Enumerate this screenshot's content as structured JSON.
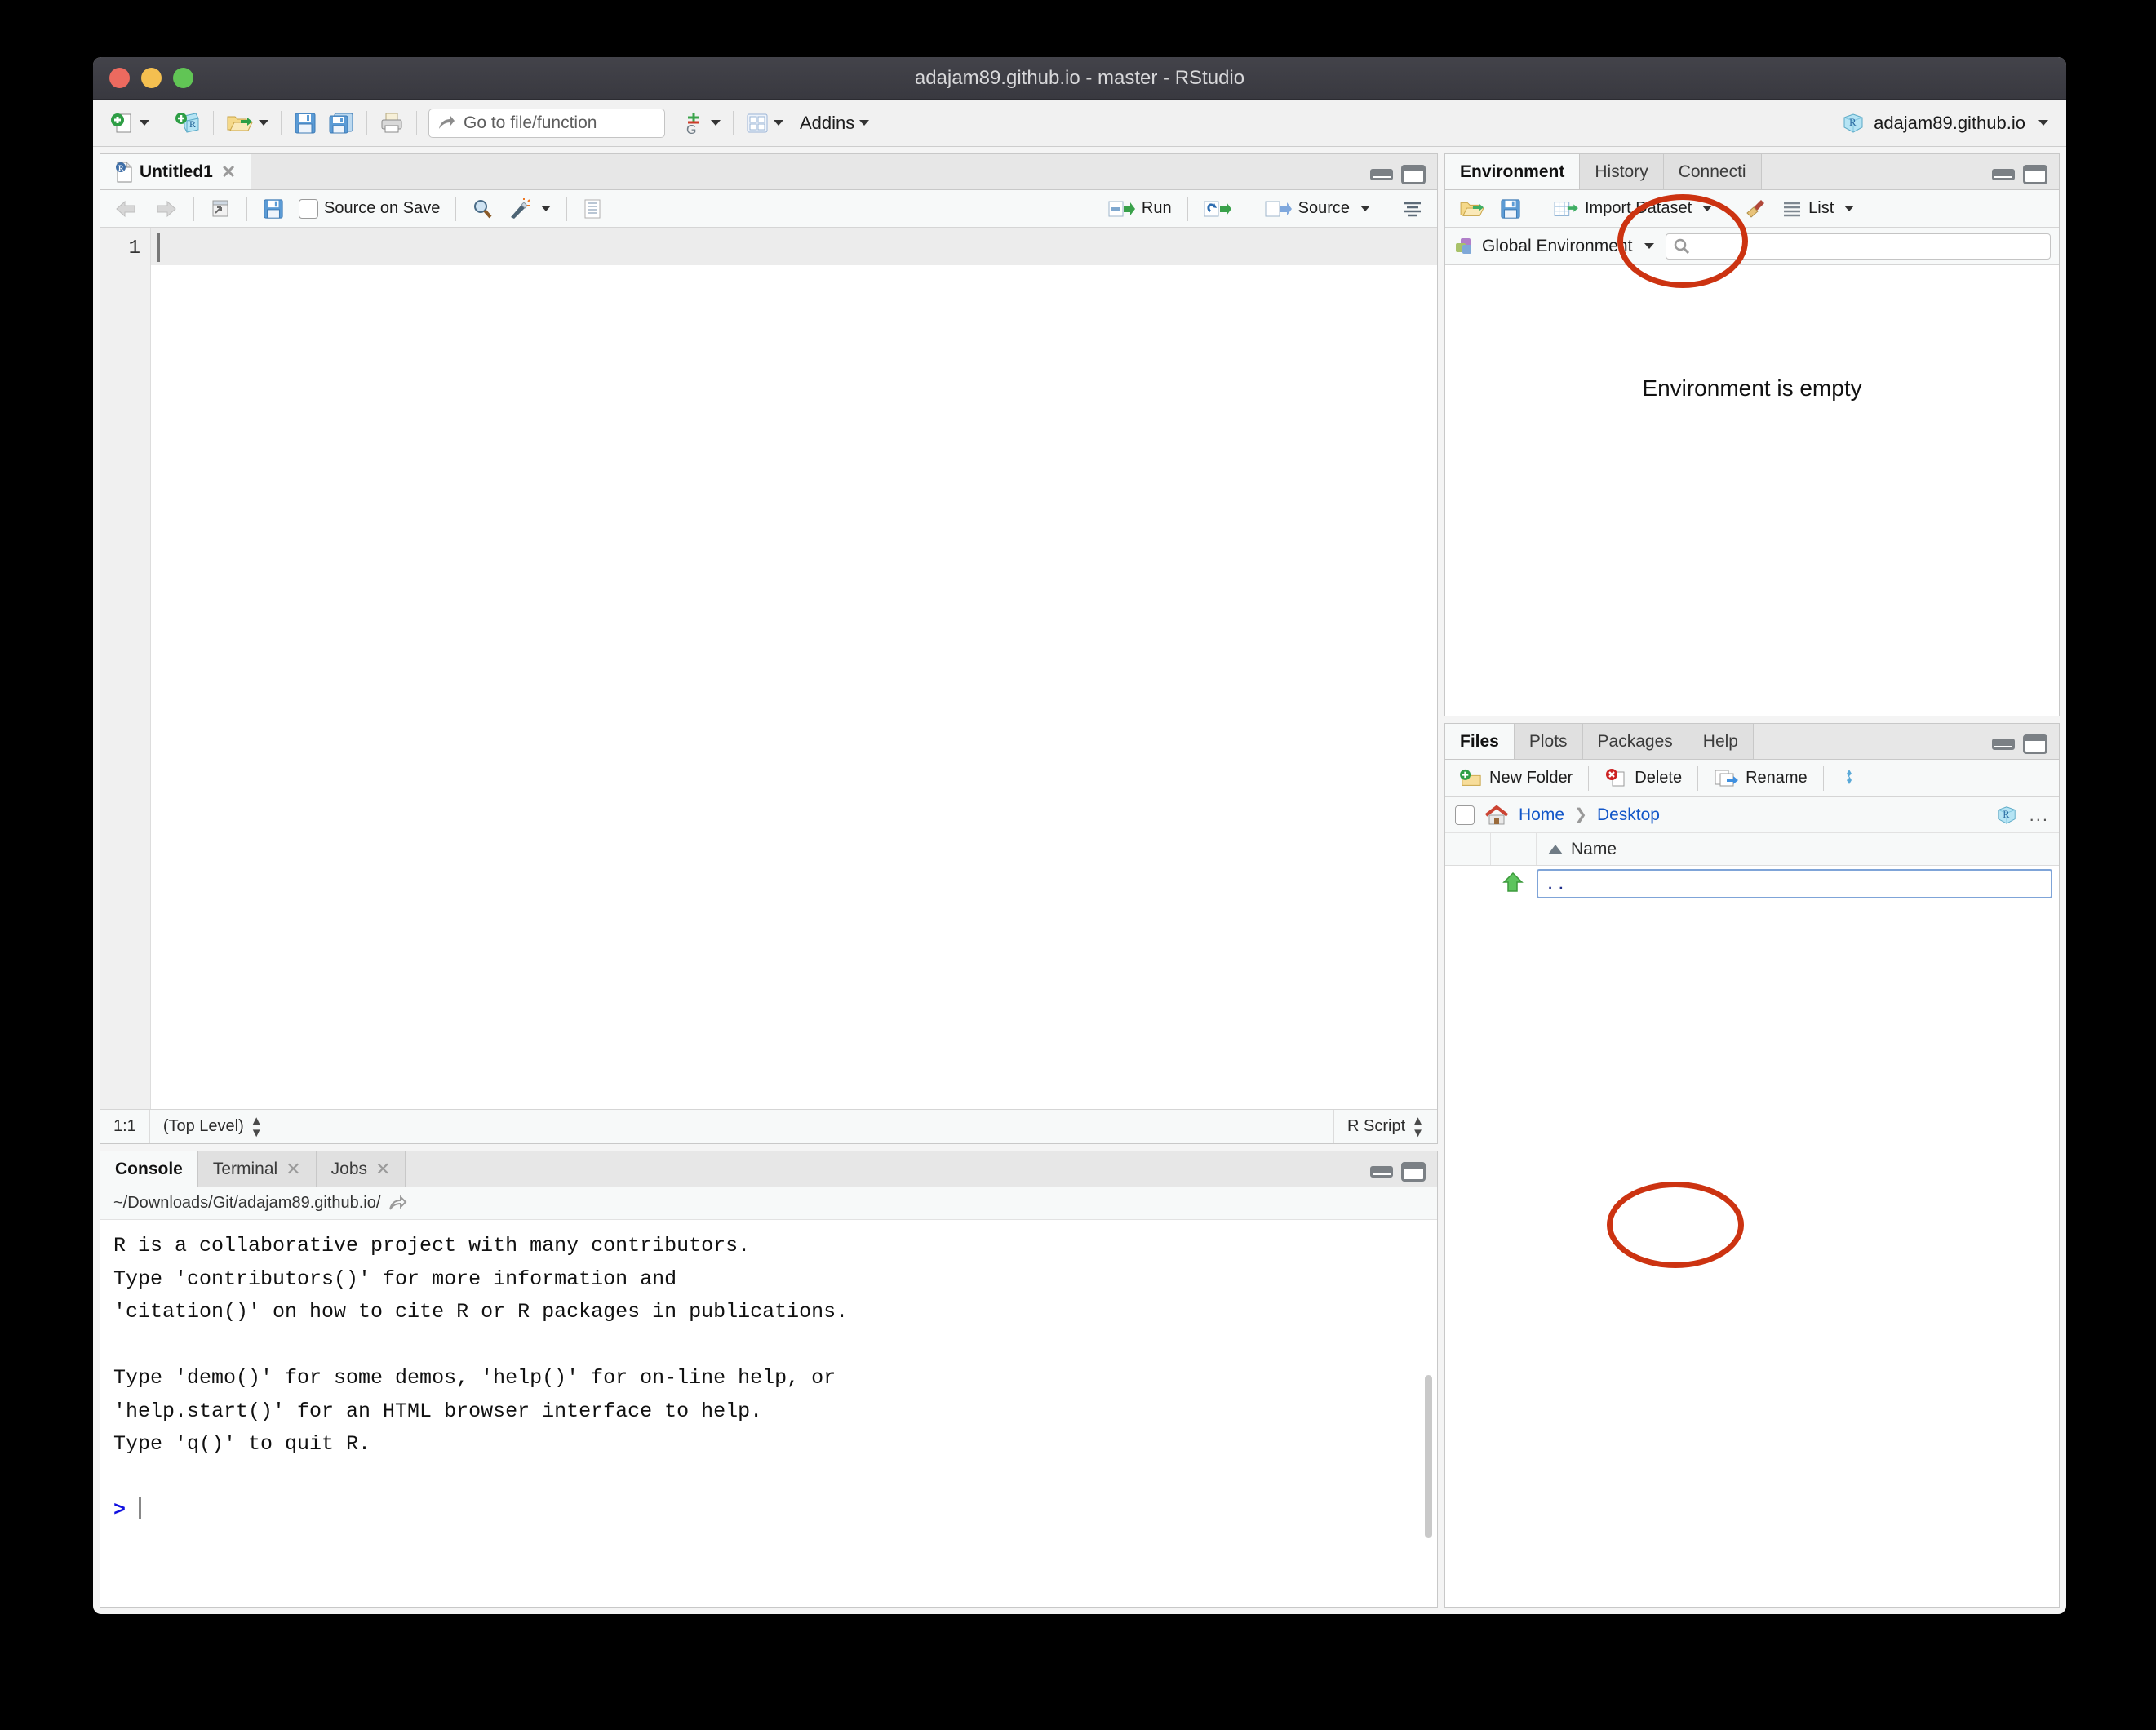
{
  "window": {
    "title": "adajam89.github.io - master - RStudio",
    "traffic_lights": [
      "close-button",
      "minimize-button",
      "maximize-button"
    ]
  },
  "toolbar": {
    "new_file_label": "new-file-icon",
    "new_project_label": "new-project-icon",
    "open_file_label": "open-file-icon",
    "save_label": "save-icon",
    "save_all_label": "save-all-icon",
    "print_label": "print-icon",
    "goto_placeholder": "Go to file/function",
    "git_label": "git-icon",
    "panes_label": "workspace-panes-icon",
    "addins_label": "Addins",
    "project_label": "adajam89.github.io"
  },
  "source": {
    "tabs": [
      {
        "label": "Untitled1",
        "closable": true,
        "active": true
      }
    ],
    "toolbar": {
      "back": "back-arrow-icon",
      "forward": "forward-arrow-icon",
      "popout": "show-in-new-window-icon",
      "save": "save-icon",
      "source_on_save": "Source on Save",
      "find": "find-icon",
      "code_tools": "code-tools-icon",
      "outline": "document-outline-icon",
      "run": "Run",
      "rerun": "re-run-icon",
      "source": "Source"
    },
    "line_numbers": [
      "1"
    ],
    "content": "",
    "status": {
      "cursor_position": "1:1",
      "scope": "(Top Level)",
      "file_type": "R Script"
    }
  },
  "console": {
    "tabs": [
      {
        "label": "Console",
        "closable": false,
        "active": true
      },
      {
        "label": "Terminal",
        "closable": true,
        "active": false
      },
      {
        "label": "Jobs",
        "closable": true,
        "active": false
      }
    ],
    "working_directory": "~/Downloads/Git/adajam89.github.io/",
    "output_lines": [
      "R is a collaborative project with many contributors.",
      "Type 'contributors()' for more information and",
      "'citation()' on how to cite R or R packages in publications.",
      "",
      "Type 'demo()' for some demos, 'help()' for on-line help, or",
      "'help.start()' for an HTML browser interface to help.",
      "Type 'q()' to quit R.",
      ""
    ],
    "prompt": ">"
  },
  "environment": {
    "tabs": [
      {
        "label": "Environment",
        "active": true
      },
      {
        "label": "History",
        "active": false
      },
      {
        "label": "Connecti",
        "active": false
      }
    ],
    "toolbar": {
      "load": "open-workspace-icon",
      "save": "save-workspace-icon",
      "import_dataset": "Import Dataset",
      "clear": "broom-icon",
      "view_mode": "List"
    },
    "scope_selector": "Global Environment",
    "search_placeholder": "",
    "empty_message": "Environment is empty"
  },
  "files": {
    "tabs": [
      {
        "label": "Files",
        "active": true
      },
      {
        "label": "Plots",
        "active": false
      },
      {
        "label": "Packages",
        "active": false
      },
      {
        "label": "Help",
        "active": false
      }
    ],
    "toolbar": {
      "new_folder": "New Folder",
      "delete": "Delete",
      "rename": "Rename",
      "more": "more-icon"
    },
    "breadcrumb": [
      "Home",
      "Desktop"
    ],
    "project_icon": "r-project-cube-icon",
    "overflow": "...",
    "columns": [
      "Name"
    ],
    "sort": {
      "column": "Name",
      "direction": "ascending"
    },
    "rows": [
      {
        "icon": "up-arrow-icon",
        "name": "..",
        "selected": true
      }
    ]
  },
  "annotations": [
    {
      "name": "source-pane-controls-highlight",
      "shape": "ellipse",
      "color": "#cc3311"
    },
    {
      "name": "console-pane-controls-highlight",
      "shape": "ellipse",
      "color": "#cc3311"
    }
  ],
  "colors": {
    "annotation": "#cc3311",
    "prompt": "#1010e0",
    "link": "#1256c8"
  }
}
